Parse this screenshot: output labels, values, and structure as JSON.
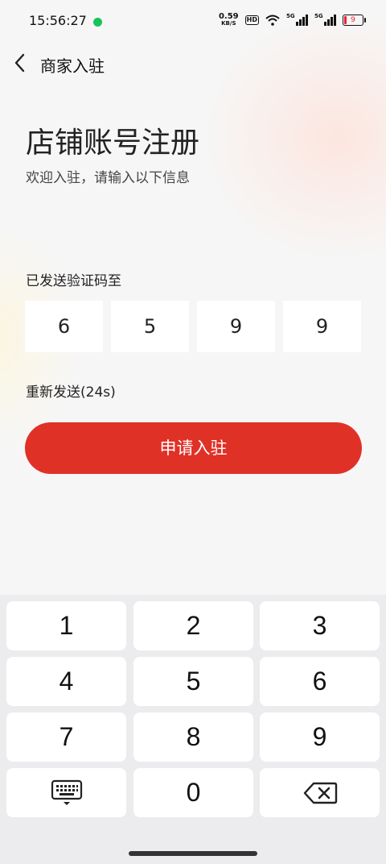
{
  "status_bar": {
    "time": "15:56:27",
    "net_speed_value": "0.59",
    "net_speed_unit": "KB/S",
    "hd_label": "HD",
    "sim1_label": "5G",
    "sim2_label": "5G",
    "battery_level": "9"
  },
  "nav": {
    "title": "商家入驻"
  },
  "header": {
    "title": "店铺账号注册",
    "subtitle": "欢迎入驻，请输入以下信息"
  },
  "verification": {
    "sent_label": "已发送验证码至",
    "digits": [
      "6",
      "5",
      "9",
      "9"
    ],
    "resend_label": "重新发送(24s)"
  },
  "submit_label": "申请入驻",
  "keypad": {
    "keys": [
      "1",
      "2",
      "3",
      "4",
      "5",
      "6",
      "7",
      "8",
      "9",
      "0"
    ]
  },
  "colors": {
    "accent": "#e03127",
    "background": "#f6f6f6",
    "keyboard_bg": "#ececef"
  }
}
